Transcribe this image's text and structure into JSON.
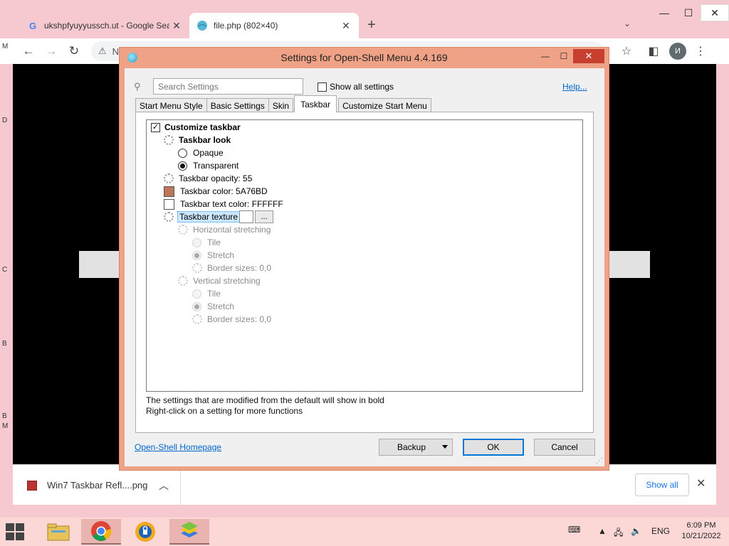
{
  "browser": {
    "tabs": [
      {
        "favicon": "G",
        "title": "ukshpfyuyyussch.ut - Google Sea"
      },
      {
        "favicon": "globe-icon",
        "title": "file.php (802×40)"
      }
    ],
    "new_tab": "+",
    "tab_dropdown": "⌄",
    "window_controls": {
      "minimize": "—",
      "maximize": "☐",
      "close": "✕"
    },
    "nav": {
      "back": "←",
      "forward": "→",
      "reload": "↻"
    },
    "omnibox_text": "N",
    "profile_initial": "И",
    "left_edge_letters": [
      "M",
      "D",
      "C",
      "B",
      "B",
      "B",
      "M"
    ]
  },
  "downloads": {
    "file_name": "Win7 Taskbar Refl....png",
    "show_all": "Show all",
    "close": "✕"
  },
  "dialog": {
    "title": "Settings for Open-Shell Menu 4.4.169",
    "controls": {
      "minimize": "—",
      "maximize": "☐",
      "close": "✕"
    },
    "search_placeholder": "Search Settings",
    "show_all_settings": "Show all settings",
    "help": "Help...",
    "tabs": [
      "Start Menu Style",
      "Basic Settings",
      "Skin",
      "Taskbar",
      "Customize Start Menu"
    ],
    "active_tab": "Taskbar",
    "tree": {
      "customize_taskbar": "Customize taskbar",
      "taskbar_look": "Taskbar look",
      "opaque": "Opaque",
      "transparent": "Transparent",
      "taskbar_opacity": "Taskbar opacity: 55",
      "taskbar_color": "Taskbar color: 5A76BD",
      "taskbar_color_hex": "#BD765A",
      "taskbar_text_color": "Taskbar text color: FFFFFF",
      "taskbar_text_color_hex": "#FFFFFF",
      "taskbar_texture": "Taskbar texture",
      "browse": "...",
      "horizontal_stretching": "Horizontal stretching",
      "h_tile": "Tile",
      "h_stretch": "Stretch",
      "h_border": "Border sizes: 0,0",
      "vertical_stretching": "Vertical stretching",
      "v_tile": "Tile",
      "v_stretch": "Stretch",
      "v_border": "Border sizes: 0,0"
    },
    "note1": "The settings that are modified from the default will show in bold",
    "note2": "Right-click on a setting for more functions",
    "homepage": "Open-Shell Homepage",
    "backup": "Backup",
    "ok": "OK",
    "cancel": "Cancel"
  },
  "taskbar": {
    "lang": "ENG",
    "time": "6:09 PM",
    "date": "10/21/2022"
  }
}
